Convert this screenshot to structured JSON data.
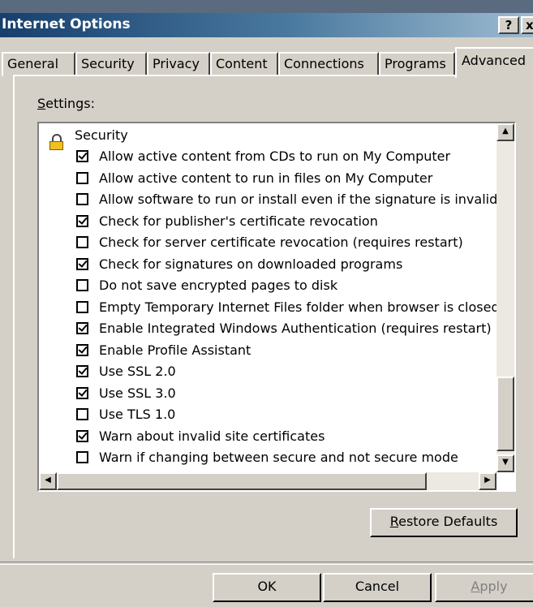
{
  "window": {
    "title": "Internet Options",
    "help_glyph": "?",
    "close_glyph": "x"
  },
  "tabs": [
    {
      "label": "General"
    },
    {
      "label": "Security"
    },
    {
      "label": "Privacy"
    },
    {
      "label": "Content"
    },
    {
      "label": "Connections"
    },
    {
      "label": "Programs"
    },
    {
      "label": "Advanced",
      "active": true
    }
  ],
  "settings": {
    "label_prefix": "S",
    "label_rest": "ettings:",
    "group": {
      "icon": "lock-icon",
      "label": "Security"
    },
    "items": [
      {
        "label": "Allow active content from CDs to run on My Computer",
        "checked": true
      },
      {
        "label": "Allow active content to run in files on My Computer",
        "checked": false
      },
      {
        "label": "Allow software to run or install even if the signature is invalid",
        "checked": false
      },
      {
        "label": "Check for publisher's certificate revocation",
        "checked": true
      },
      {
        "label": "Check for server certificate revocation (requires restart)",
        "checked": false
      },
      {
        "label": "Check for signatures on downloaded programs",
        "checked": true
      },
      {
        "label": "Do not save encrypted pages to disk",
        "checked": false
      },
      {
        "label": "Empty Temporary Internet Files folder when browser is closed",
        "checked": false
      },
      {
        "label": "Enable Integrated Windows Authentication (requires restart)",
        "checked": true
      },
      {
        "label": "Enable Profile Assistant",
        "checked": true
      },
      {
        "label": "Use SSL 2.0",
        "checked": true
      },
      {
        "label": "Use SSL 3.0",
        "checked": true
      },
      {
        "label": "Use TLS 1.0",
        "checked": false
      },
      {
        "label": "Warn about invalid site certificates",
        "checked": true
      },
      {
        "label": "Warn if changing between secure and not secure mode",
        "checked": false
      }
    ]
  },
  "buttons": {
    "restore_prefix": "R",
    "restore_rest": "estore Defaults",
    "ok": "OK",
    "cancel": "Cancel",
    "apply_prefix": "A",
    "apply_rest": "pply"
  },
  "colors": {
    "face": "#d4d0c8",
    "title_start": "#163f6d",
    "title_end": "#9dbbd0",
    "disabled_text": "#808080"
  }
}
